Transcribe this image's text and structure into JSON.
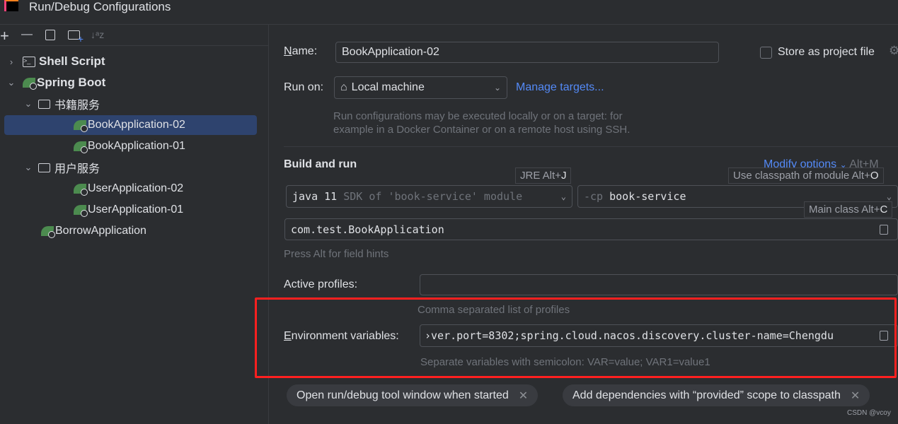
{
  "window": {
    "title": "Run/Debug Configurations"
  },
  "toolbar": {
    "add": "+",
    "remove": "—",
    "sort": "↓ᵃz"
  },
  "tree": [
    {
      "label": "Shell Script",
      "icon": "terminal-icon",
      "expanded": false,
      "level": 0
    },
    {
      "label": "Spring Boot",
      "icon": "spring-boot-icon",
      "expanded": true,
      "level": 0
    },
    {
      "label": "书籍服务",
      "icon": "folder-icon",
      "expanded": true,
      "level": 1
    },
    {
      "label": "BookApplication-02",
      "icon": "spring-boot-icon",
      "level": 2,
      "selected": true
    },
    {
      "label": "BookApplication-01",
      "icon": "spring-boot-icon",
      "level": 2
    },
    {
      "label": "用户服务",
      "icon": "folder-icon",
      "expanded": true,
      "level": 1
    },
    {
      "label": "UserApplication-02",
      "icon": "spring-boot-icon",
      "level": 2
    },
    {
      "label": "UserApplication-01",
      "icon": "spring-boot-icon",
      "level": 2
    },
    {
      "label": "BorrowApplication",
      "icon": "spring-boot-icon",
      "level": 1
    }
  ],
  "form": {
    "name_label": "Name:",
    "name_value": "BookApplication-02",
    "store_label": "Store as project file",
    "run_on_label": "Run on:",
    "run_on_value": "Local machine",
    "manage_targets": "Manage targets...",
    "run_on_hint_1": "Run configurations may be executed locally or on a target: for",
    "run_on_hint_2": "example in a Docker Container or on a remote host using SSH.",
    "build_run": "Build and run",
    "modify_options": "Modify options",
    "modify_shortcut": "Alt+M",
    "jre_tip": "JRE Alt+",
    "jre_key": "J",
    "cp_tip": "Use classpath of module Alt+",
    "cp_key": "O",
    "main_tip": "Main class Alt+",
    "main_key": "C",
    "jdk_value": "java 11",
    "jdk_hint": "SDK of 'book-service' module",
    "cp_prefix": "-cp",
    "cp_value": "book-service",
    "main_class": "com.test.BookApplication",
    "field_hints": "Press Alt for field hints",
    "profiles_label": "Active profiles:",
    "profiles_hint": "Comma separated list of profiles",
    "env_label": "Environment variables:",
    "env_value": "›ver.port=8302;spring.cloud.nacos.discovery.cluster-name=Chengdu",
    "env_hint": "Separate variables with semicolon: VAR=value; VAR1=value1"
  },
  "chips": [
    "Open run/debug tool window when started",
    "Add dependencies with “provided” scope to classpath"
  ],
  "watermark": "CSDN @vcoy",
  "colors": {
    "accent": "#548af7",
    "selection": "#2e436e",
    "highlight_box": "#ff2020"
  }
}
